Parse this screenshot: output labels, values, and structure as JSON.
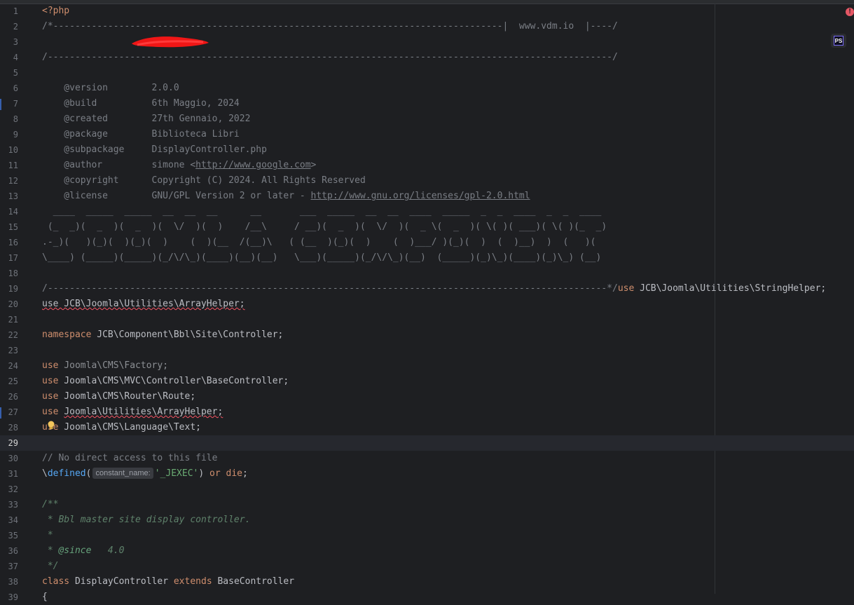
{
  "editor": {
    "lines": [
      {
        "n": "1",
        "segs": [
          {
            "t": "<?php",
            "c": "kw"
          }
        ]
      },
      {
        "n": "2",
        "segs": [
          {
            "t": "/*----------------------------------------------------------------------------------|  www.vdm.io  |----/",
            "c": "cm"
          }
        ]
      },
      {
        "n": "3",
        "segs": [
          {
            "t": "",
            "c": "cm"
          }
        ]
      },
      {
        "n": "4",
        "segs": [
          {
            "t": "/-------------------------------------------------------------------------------------------------------/",
            "c": "cm"
          }
        ]
      },
      {
        "n": "5",
        "segs": [
          {
            "t": "",
            "c": "cm"
          }
        ]
      },
      {
        "n": "6",
        "segs": [
          {
            "t": "    @version        2.0.0",
            "c": "cm"
          }
        ]
      },
      {
        "n": "7",
        "segs": [
          {
            "t": "    @build          6th Maggio, 2024",
            "c": "cm"
          }
        ]
      },
      {
        "n": "8",
        "segs": [
          {
            "t": "    @created        27th Gennaio, 2022",
            "c": "cm"
          }
        ]
      },
      {
        "n": "9",
        "segs": [
          {
            "t": "    @package        Biblioteca Libri",
            "c": "cm"
          }
        ]
      },
      {
        "n": "10",
        "segs": [
          {
            "t": "    @subpackage     DisplayController.php",
            "c": "cm"
          }
        ]
      },
      {
        "n": "11",
        "segs": [
          {
            "t": "    @author         simone <",
            "c": "cm"
          },
          {
            "t": "http://www.google.com",
            "c": "cm link"
          },
          {
            "t": ">",
            "c": "cm"
          }
        ]
      },
      {
        "n": "12",
        "segs": [
          {
            "t": "    @copyright      Copyright (C) 2024. All Rights Reserved",
            "c": "cm"
          }
        ]
      },
      {
        "n": "13",
        "segs": [
          {
            "t": "    @license        GNU/GPL Version 2 or later - ",
            "c": "cm"
          },
          {
            "t": "http://www.gnu.org/licenses/gpl-2.0.html",
            "c": "cm link"
          }
        ]
      },
      {
        "n": "14",
        "segs": [
          {
            "t": "  ____  _____  _____  __  __  __      __       ___  _____  __  __  ____  _____  _  _  ____  _  _  ____",
            "c": "cm"
          }
        ]
      },
      {
        "n": "15",
        "segs": [
          {
            "t": " (_  _)(  _  )(  _  )(  \\/  )(  )    /__\\     / __)(  _  )(  \\/  )(  _ \\(  _  )( \\( )( ___)( \\( )(_  _)",
            "c": "cm"
          }
        ]
      },
      {
        "n": "16",
        "segs": [
          {
            "t": ".-_)(   )(_)(  )(_)(  )    (  )(__  /(__)\\   ( (__  )(_)(  )    (  )___/ )(_)(  )  (  )__)  )  (   )(",
            "c": "cm"
          }
        ]
      },
      {
        "n": "17",
        "segs": [
          {
            "t": "\\____) (_____)(_____)(_/\\/\\_)(____)(__)(__)   \\___)(_____)(_/\\/\\_)(__)  (_____)(_)\\_)(____)(_)\\_) (__)",
            "c": "cm"
          }
        ]
      },
      {
        "n": "18",
        "segs": [
          {
            "t": "",
            "c": "cm"
          }
        ]
      },
      {
        "n": "19",
        "segs": [
          {
            "t": "/------------------------------------------------------------------------------------------------------*/",
            "c": "cm"
          },
          {
            "t": "use",
            "c": "kw"
          },
          {
            "t": " JCB\\Joomla\\Utilities\\StringHelper;",
            "c": "ns"
          }
        ]
      },
      {
        "n": "20",
        "segs": [
          {
            "t": "use JCB\\Joomla\\Utilities\\ArrayHelper;",
            "c": "ns squig"
          }
        ]
      },
      {
        "n": "21",
        "segs": [
          {
            "t": "",
            "c": "ns"
          }
        ]
      },
      {
        "n": "22",
        "segs": [
          {
            "t": "namespace",
            "c": "kw"
          },
          {
            "t": " JCB\\Component\\Bbl\\Site\\Controller;",
            "c": "ns"
          }
        ]
      },
      {
        "n": "23",
        "segs": [
          {
            "t": "",
            "c": "ns"
          }
        ]
      },
      {
        "n": "24",
        "segs": [
          {
            "t": "use",
            "c": "kw"
          },
          {
            "t": " Joomla\\CMS\\Factory;",
            "c": "dim"
          }
        ]
      },
      {
        "n": "25",
        "segs": [
          {
            "t": "use",
            "c": "kw"
          },
          {
            "t": " Joomla\\CMS\\MVC\\Controller\\BaseController;",
            "c": "ns"
          }
        ]
      },
      {
        "n": "26",
        "segs": [
          {
            "t": "use",
            "c": "kw"
          },
          {
            "t": " Joomla\\CMS\\Router\\Route;",
            "c": "ns"
          }
        ]
      },
      {
        "n": "27",
        "segs": [
          {
            "t": "use",
            "c": "kw"
          },
          {
            "t": " ",
            "c": "ns"
          },
          {
            "t": "Joomla\\Utilities\\ArrayHelper;",
            "c": "ns squig"
          }
        ]
      },
      {
        "n": "28",
        "segs": [
          {
            "t": "use",
            "c": "kw"
          },
          {
            "t": " Joomla\\CMS\\Language\\Text;",
            "c": "ns"
          }
        ]
      },
      {
        "n": "29",
        "segs": [
          {
            "t": "",
            "c": "ns"
          }
        ]
      },
      {
        "n": "30",
        "segs": [
          {
            "t": "// No direct access to this file",
            "c": "cm"
          }
        ]
      },
      {
        "n": "31",
        "segs": [
          {
            "t": "\\",
            "c": "ns"
          },
          {
            "t": "defined",
            "c": "fn"
          },
          {
            "t": "(",
            "c": "ns"
          },
          {
            "t": "constant_name:",
            "c": "hint"
          },
          {
            "t": "'_JEXEC'",
            "c": "str"
          },
          {
            "t": ") ",
            "c": "ns"
          },
          {
            "t": "or",
            "c": "kw"
          },
          {
            "t": " ",
            "c": "ns"
          },
          {
            "t": "die",
            "c": "kw"
          },
          {
            "t": ";",
            "c": "ns"
          }
        ]
      },
      {
        "n": "32",
        "segs": [
          {
            "t": "",
            "c": "ns"
          }
        ]
      },
      {
        "n": "33",
        "segs": [
          {
            "t": "/**",
            "c": "doc"
          }
        ]
      },
      {
        "n": "34",
        "segs": [
          {
            "t": " * Bbl master site display controller.",
            "c": "doc"
          }
        ]
      },
      {
        "n": "35",
        "segs": [
          {
            "t": " *",
            "c": "doc"
          }
        ]
      },
      {
        "n": "36",
        "segs": [
          {
            "t": " * ",
            "c": "doc"
          },
          {
            "t": "@since",
            "c": "doctag"
          },
          {
            "t": "   4.0",
            "c": "doc"
          }
        ]
      },
      {
        "n": "37",
        "segs": [
          {
            "t": " */",
            "c": "doc"
          }
        ]
      },
      {
        "n": "38",
        "segs": [
          {
            "t": "class",
            "c": "kw"
          },
          {
            "t": " DisplayController ",
            "c": "ns"
          },
          {
            "t": "extends",
            "c": "kw"
          },
          {
            "t": " BaseController",
            "c": "ns"
          }
        ]
      },
      {
        "n": "39",
        "segs": [
          {
            "t": "{",
            "c": "ns"
          }
        ]
      }
    ],
    "current_line": "29"
  },
  "icons": {
    "error": "error-icon",
    "phpstorm": "phpstorm-icon",
    "intention": "lightbulb-icon"
  },
  "labels": {
    "error_glyph": "!",
    "ps_glyph": "PS"
  }
}
